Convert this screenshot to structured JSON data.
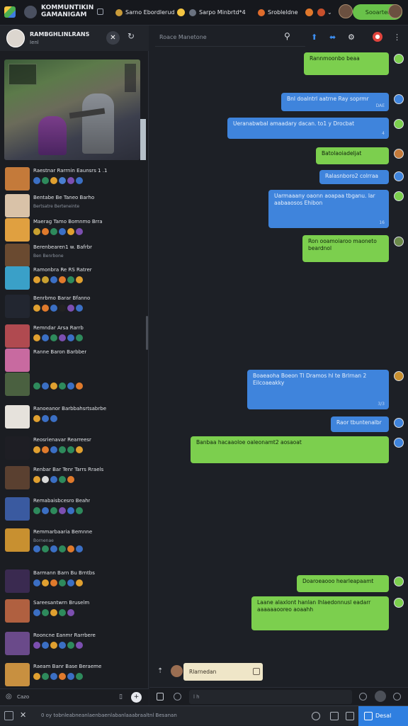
{
  "app": {
    "title_line1": "KOMMUNTIKIN",
    "title_line2": "GAMANIGAM"
  },
  "topbar": {
    "chips": [
      {
        "label": "Sarno Ebordlerud",
        "color": "#f0b23a"
      },
      {
        "label": "Sarpo Minbrtd*4",
        "color": "#e06c2c"
      },
      {
        "label": "Srobleldne",
        "color": "#e05a3a"
      }
    ],
    "right_chip": "Sooarter"
  },
  "sidebar": {
    "header_title": "RAMBGHLINLRANS",
    "header_sub": "Ienl",
    "players": [
      {
        "name": "Raestnar Rarrnin Eaunsrs 1 .1",
        "sub": "",
        "icons": [
          "#3b6fc4",
          "#2e8a5c",
          "#e0a030",
          "#4a7fd0",
          "#7c4fb0",
          "#3b6fc4"
        ],
        "color": "#c47a3a"
      },
      {
        "name": "Bentabe Be Taneo Barho",
        "sub": "Bertsatre Berteneinte",
        "icons": [],
        "color": "#d9c2a8"
      },
      {
        "name": "Maerag Tamo Bomnmo Brra",
        "sub": "",
        "icons": [
          "#c8a030",
          "#e07a2c",
          "#2e8a5c",
          "#3b6fc4",
          "#e0a030",
          "#7c4fb0"
        ],
        "color": "#e0a040"
      },
      {
        "name": "Berenbearen1 w. Bafrbr",
        "sub": "Ben Benrbone",
        "icons": [],
        "color": "#6a4a30"
      },
      {
        "name": "Ramonbra Re RS Ratrer",
        "sub": "",
        "icons": [
          "#e0a030",
          "#c8a030",
          "#3b6fc4",
          "#e07a2c",
          "#2e8a5c",
          "#e0a030"
        ],
        "color": "#3aa0c8"
      },
      {
        "name": "Benrbmo Barar Bfanno",
        "sub": "",
        "icons": [
          "#e0a030",
          "#e07a2c",
          "#3b6fc4",
          "#222",
          "#7c4fb0",
          "#3b6fc4"
        ],
        "color": "#222630"
      },
      {
        "name": "Remndar Arsa Rarrb",
        "sub": "",
        "icons": [
          "#e0a030",
          "#3b6fc4",
          "#2e8a5c",
          "#7c4fb0",
          "#3b6fc4",
          "#2e8a5c"
        ],
        "color": "#b04a50"
      },
      {
        "name": "Ranne Baron Barbber",
        "sub": "",
        "icons": [],
        "color": "#c86aa0"
      },
      {
        "name": "",
        "sub": "",
        "icons": [
          "#2e8a5c",
          "#3b6fc4",
          "#e0a030",
          "#2e8a5c",
          "#3b6fc4",
          "#e07a2c"
        ],
        "color": "#4a6040"
      },
      {
        "name": "Ranoeanor Barbbahsrtsabrbe",
        "sub": "",
        "icons": [
          "#e0a030",
          "#3b6fc4",
          "#3b6fc4"
        ],
        "color": "#e6e2dc"
      },
      {
        "name": "Reosrienavar Rearreesr",
        "sub": "",
        "icons": [
          "#e0a030",
          "#e07a2c",
          "#3b6fc4",
          "#2e8a5c",
          "#2e8a5c",
          "#e0a030"
        ],
        "color": "#1e1e24"
      },
      {
        "name": "Renbar Bar Tenr Tarrs Rraels",
        "sub": "",
        "icons": [
          "#e0a030",
          "#d9d9d9",
          "#3b6fc4",
          "#2e8a5c",
          "#e07a2c"
        ],
        "color": "#5a4030"
      },
      {
        "name": "Remabaisbcesro Beahr",
        "sub": "",
        "icons": [
          "#2e8a5c",
          "#3b6fc4",
          "#2e8a5c",
          "#7c4fb0",
          "#3b6fc4",
          "#2e8a5c"
        ],
        "color": "#3a5aa0"
      },
      {
        "name": "Remmarbaaria Bemnne",
        "sub": "Bornenae",
        "icons": [
          "#3b6fc4",
          "#2e8a5c",
          "#3b6fc4",
          "#2e8a5c",
          "#e07a2c",
          "#3b6fc4"
        ],
        "color": "#c89030"
      },
      {
        "name": "Barmann Barn Bu Brntbs",
        "sub": "",
        "icons": [
          "#3b6fc4",
          "#e0a030",
          "#e07a2c",
          "#2e8a5c",
          "#3b6fc4",
          "#e0a030"
        ],
        "color": "#3a2a50"
      },
      {
        "name": "Sareesantwrn Bruselm",
        "sub": "",
        "icons": [
          "#3b6fc4",
          "#2e8a5c",
          "#e0a030",
          "#2e8a5c",
          "#7c4fb0"
        ],
        "color": "#b06040"
      },
      {
        "name": "Rooncne Eanmr Rarrbere",
        "sub": "",
        "icons": [
          "#7c4fb0",
          "#3b6fc4",
          "#e0a030",
          "#3b6fc4",
          "#2e8a5c",
          "#7c4fb0"
        ],
        "color": "#6a4a8a"
      },
      {
        "name": "Raeam Banr Base Beraeme",
        "sub": "",
        "icons": [
          "#e0a030",
          "#2e8a5c",
          "#3b6fc4",
          "#e07a2c",
          "#3b6fc4",
          "#2e8a5c"
        ],
        "color": "#c89040"
      }
    ],
    "footer_label": "Cazo"
  },
  "main": {
    "search_placeholder": "Roace Manetone",
    "messages": [
      {
        "side": "right",
        "color": "green",
        "text": "Rannmoonbo beaa",
        "meta": ""
      },
      {
        "side": "right",
        "color": "blue",
        "text": "Bnl doalntrl aatrne Ray soprmr",
        "meta": "DAE"
      },
      {
        "side": "right",
        "color": "blue",
        "text": "Ueranabwbal amaadary dacan.  to1 y Drocbat",
        "meta": "4"
      },
      {
        "side": "right",
        "color": "green",
        "text": "Batolaoiadeljat",
        "meta": ""
      },
      {
        "side": "right",
        "color": "blue",
        "text": "Ralasnboro2 colrraa",
        "meta": ""
      },
      {
        "side": "right",
        "color": "blue",
        "text": "Uarmaaany oaonn aoapaa tbganu. lar aabaaosos Ehibon",
        "meta": "16"
      },
      {
        "side": "right",
        "color": "green",
        "text": "Ron ooamoiaroo maoneto beardnol",
        "meta": ""
      },
      {
        "side": "right",
        "color": "blue",
        "text": "Boaeaoha Boeon Tl Dramos hl te Brlrnan 2 Eilcoaeakky",
        "meta": "3/3"
      },
      {
        "side": "right",
        "color": "blue",
        "text": "Raor tbuntenalbr",
        "meta": ""
      },
      {
        "side": "right",
        "color": "green",
        "text": "Banbaa hacaaoloe oaleonamt2 aosaoat",
        "meta": ""
      },
      {
        "side": "right",
        "color": "green",
        "text": "Doaroeaooo hearleapaamt",
        "meta": ""
      },
      {
        "side": "right",
        "color": "green",
        "text": "Laane alaxlont hanlan lhlaedonnusl eadarr aaaaaaooreo aoaahh",
        "meta": ""
      }
    ],
    "compose_chip": "Rlarnedan",
    "input_placeholder": "l h"
  },
  "bottombar": {
    "status": "0 oy tobnleabneanlaenbaenlabanlaaabraaltnl Besanan",
    "send_label": "Desal"
  }
}
